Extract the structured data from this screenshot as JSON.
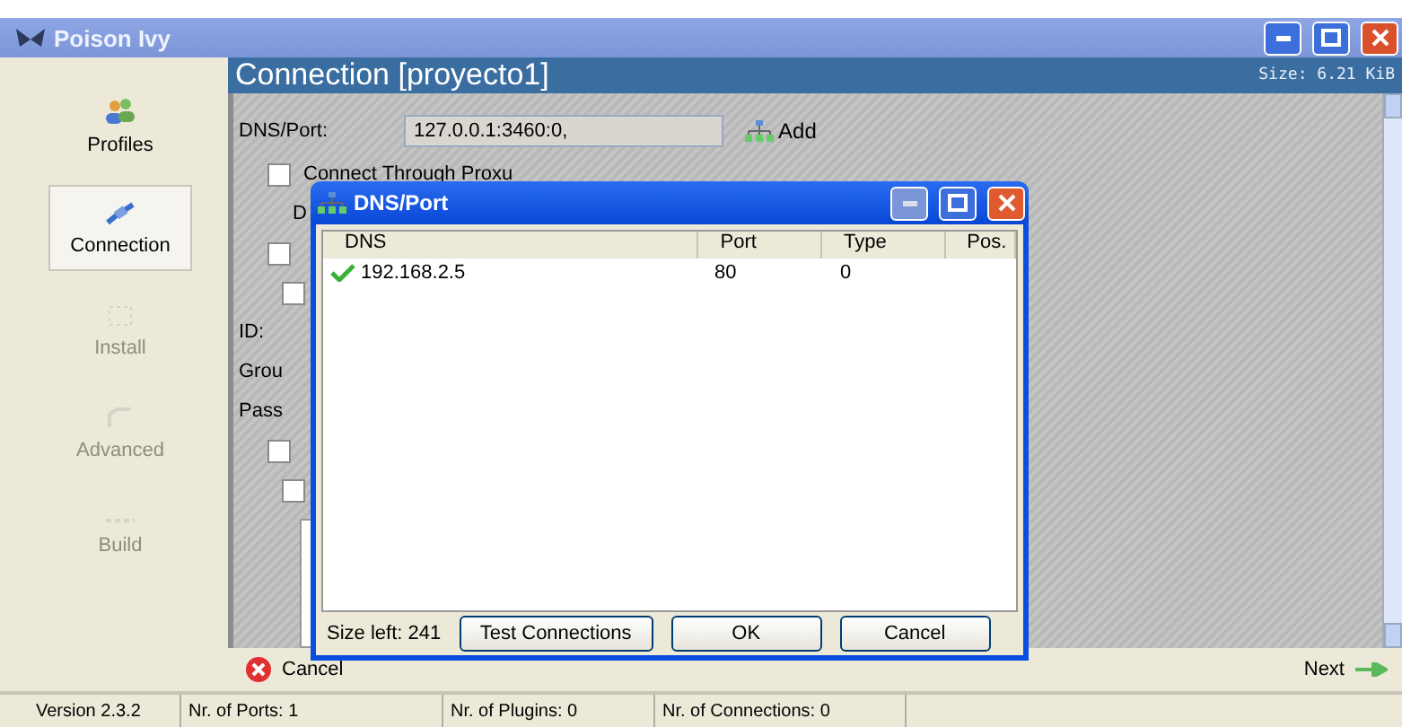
{
  "window": {
    "title": "Poison Ivy"
  },
  "sidebar": {
    "items": [
      {
        "label": "Profiles",
        "selected": false,
        "disabled": false
      },
      {
        "label": "Connection",
        "selected": true,
        "disabled": false
      },
      {
        "label": "Install",
        "selected": false,
        "disabled": true
      },
      {
        "label": "Advanced",
        "selected": false,
        "disabled": true
      },
      {
        "label": "Build",
        "selected": false,
        "disabled": true
      }
    ]
  },
  "header": {
    "title": "Connection [proyecto1]",
    "size": "Size: 6.21 KiB"
  },
  "form": {
    "dns_label": "DNS/Port:",
    "dns_value": "127.0.0.1:3460:0,",
    "add_button": "Add",
    "items": [
      {
        "kind": "checkbox",
        "label": "Connect Through Proxu",
        "checked": false
      },
      {
        "kind": "subtext",
        "label": "D"
      },
      {
        "kind": "checkbox",
        "checked": false
      },
      {
        "kind": "subcheckbox",
        "checked": false
      },
      {
        "kind": "text",
        "label": "ID:"
      },
      {
        "kind": "text",
        "label": "Grou"
      },
      {
        "kind": "text",
        "label": "Pass"
      },
      {
        "kind": "checkbox",
        "checked": false
      },
      {
        "kind": "subcheckbox",
        "checked": false
      }
    ]
  },
  "footer": {
    "cancel": "Cancel",
    "next": "Next"
  },
  "status_bar": [
    "Version 2.3.2",
    "Nr. of Ports: 1",
    "Nr. of Plugins: 0",
    "Nr. of Connections: 0"
  ],
  "dialog": {
    "title": "DNS/Port",
    "columns": [
      "DNS",
      "Port",
      "Type",
      "Pos."
    ],
    "rows": [
      {
        "dns": "192.168.2.5",
        "port": "80",
        "type": "0"
      }
    ],
    "size_left": "Size left: 241",
    "buttons": [
      "Test Connections",
      "OK",
      "Cancel"
    ]
  }
}
